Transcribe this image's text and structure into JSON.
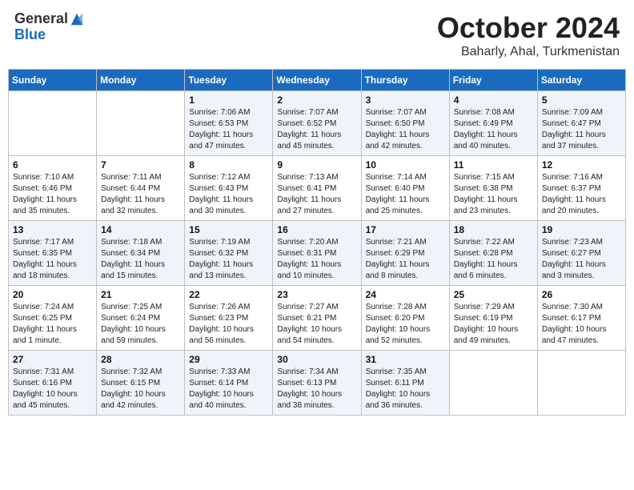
{
  "header": {
    "logo_line1": "General",
    "logo_line2": "Blue",
    "month": "October 2024",
    "location": "Baharly, Ahal, Turkmenistan"
  },
  "days_of_week": [
    "Sunday",
    "Monday",
    "Tuesday",
    "Wednesday",
    "Thursday",
    "Friday",
    "Saturday"
  ],
  "weeks": [
    [
      {
        "day": "",
        "detail": ""
      },
      {
        "day": "",
        "detail": ""
      },
      {
        "day": "1",
        "detail": "Sunrise: 7:06 AM\nSunset: 6:53 PM\nDaylight: 11 hours and 47 minutes."
      },
      {
        "day": "2",
        "detail": "Sunrise: 7:07 AM\nSunset: 6:52 PM\nDaylight: 11 hours and 45 minutes."
      },
      {
        "day": "3",
        "detail": "Sunrise: 7:07 AM\nSunset: 6:50 PM\nDaylight: 11 hours and 42 minutes."
      },
      {
        "day": "4",
        "detail": "Sunrise: 7:08 AM\nSunset: 6:49 PM\nDaylight: 11 hours and 40 minutes."
      },
      {
        "day": "5",
        "detail": "Sunrise: 7:09 AM\nSunset: 6:47 PM\nDaylight: 11 hours and 37 minutes."
      }
    ],
    [
      {
        "day": "6",
        "detail": "Sunrise: 7:10 AM\nSunset: 6:46 PM\nDaylight: 11 hours and 35 minutes."
      },
      {
        "day": "7",
        "detail": "Sunrise: 7:11 AM\nSunset: 6:44 PM\nDaylight: 11 hours and 32 minutes."
      },
      {
        "day": "8",
        "detail": "Sunrise: 7:12 AM\nSunset: 6:43 PM\nDaylight: 11 hours and 30 minutes."
      },
      {
        "day": "9",
        "detail": "Sunrise: 7:13 AM\nSunset: 6:41 PM\nDaylight: 11 hours and 27 minutes."
      },
      {
        "day": "10",
        "detail": "Sunrise: 7:14 AM\nSunset: 6:40 PM\nDaylight: 11 hours and 25 minutes."
      },
      {
        "day": "11",
        "detail": "Sunrise: 7:15 AM\nSunset: 6:38 PM\nDaylight: 11 hours and 23 minutes."
      },
      {
        "day": "12",
        "detail": "Sunrise: 7:16 AM\nSunset: 6:37 PM\nDaylight: 11 hours and 20 minutes."
      }
    ],
    [
      {
        "day": "13",
        "detail": "Sunrise: 7:17 AM\nSunset: 6:35 PM\nDaylight: 11 hours and 18 minutes."
      },
      {
        "day": "14",
        "detail": "Sunrise: 7:18 AM\nSunset: 6:34 PM\nDaylight: 11 hours and 15 minutes."
      },
      {
        "day": "15",
        "detail": "Sunrise: 7:19 AM\nSunset: 6:32 PM\nDaylight: 11 hours and 13 minutes."
      },
      {
        "day": "16",
        "detail": "Sunrise: 7:20 AM\nSunset: 6:31 PM\nDaylight: 11 hours and 10 minutes."
      },
      {
        "day": "17",
        "detail": "Sunrise: 7:21 AM\nSunset: 6:29 PM\nDaylight: 11 hours and 8 minutes."
      },
      {
        "day": "18",
        "detail": "Sunrise: 7:22 AM\nSunset: 6:28 PM\nDaylight: 11 hours and 6 minutes."
      },
      {
        "day": "19",
        "detail": "Sunrise: 7:23 AM\nSunset: 6:27 PM\nDaylight: 11 hours and 3 minutes."
      }
    ],
    [
      {
        "day": "20",
        "detail": "Sunrise: 7:24 AM\nSunset: 6:25 PM\nDaylight: 11 hours and 1 minute."
      },
      {
        "day": "21",
        "detail": "Sunrise: 7:25 AM\nSunset: 6:24 PM\nDaylight: 10 hours and 59 minutes."
      },
      {
        "day": "22",
        "detail": "Sunrise: 7:26 AM\nSunset: 6:23 PM\nDaylight: 10 hours and 56 minutes."
      },
      {
        "day": "23",
        "detail": "Sunrise: 7:27 AM\nSunset: 6:21 PM\nDaylight: 10 hours and 54 minutes."
      },
      {
        "day": "24",
        "detail": "Sunrise: 7:28 AM\nSunset: 6:20 PM\nDaylight: 10 hours and 52 minutes."
      },
      {
        "day": "25",
        "detail": "Sunrise: 7:29 AM\nSunset: 6:19 PM\nDaylight: 10 hours and 49 minutes."
      },
      {
        "day": "26",
        "detail": "Sunrise: 7:30 AM\nSunset: 6:17 PM\nDaylight: 10 hours and 47 minutes."
      }
    ],
    [
      {
        "day": "27",
        "detail": "Sunrise: 7:31 AM\nSunset: 6:16 PM\nDaylight: 10 hours and 45 minutes."
      },
      {
        "day": "28",
        "detail": "Sunrise: 7:32 AM\nSunset: 6:15 PM\nDaylight: 10 hours and 42 minutes."
      },
      {
        "day": "29",
        "detail": "Sunrise: 7:33 AM\nSunset: 6:14 PM\nDaylight: 10 hours and 40 minutes."
      },
      {
        "day": "30",
        "detail": "Sunrise: 7:34 AM\nSunset: 6:13 PM\nDaylight: 10 hours and 38 minutes."
      },
      {
        "day": "31",
        "detail": "Sunrise: 7:35 AM\nSunset: 6:11 PM\nDaylight: 10 hours and 36 minutes."
      },
      {
        "day": "",
        "detail": ""
      },
      {
        "day": "",
        "detail": ""
      }
    ]
  ]
}
